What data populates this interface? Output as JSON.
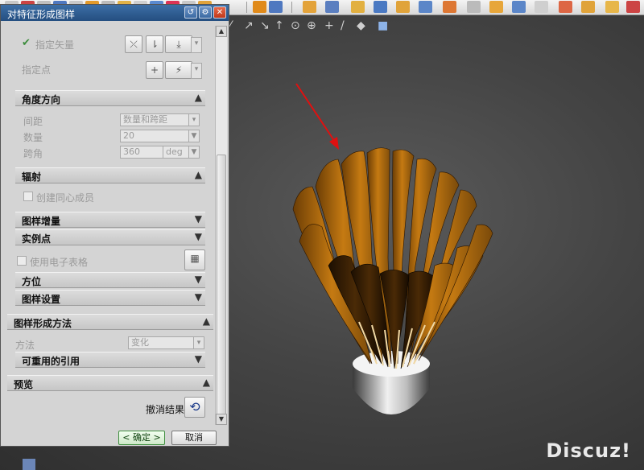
{
  "toolbar": {
    "icons": [
      "feature-icon",
      "cylinder-icon",
      "block-icon",
      "extrude-icon",
      "revolve-icon",
      "boss-icon",
      "pocket-icon",
      "pad-icon",
      "slot-icon",
      "groove-icon",
      "sweep-icon",
      "shell-icon",
      "chamfer-icon",
      "blend-icon",
      "draft-icon",
      "offset-icon",
      "trim-icon",
      "split-icon",
      "sew-icon",
      "pattern-icon",
      "mirror-icon",
      "box-icon",
      "edge-blend-icon"
    ]
  },
  "snapbar": {
    "icons": [
      "line-snap-icon",
      "midpoint-icon",
      "control-point-icon",
      "arc-center-icon",
      "quadrant-icon",
      "intersection-icon",
      "tangent-icon",
      "point-on-curve-icon",
      "face-icon"
    ]
  },
  "dialog": {
    "title": "对特征形成图样",
    "vector_label": "指定矢量",
    "point_label": "指定点",
    "angle_section": "角度方向",
    "spacing_label": "间距",
    "spacing_value": "数量和跨距",
    "count_label": "数量",
    "count_value": "20",
    "span_label": "跨角",
    "span_value": "360",
    "span_unit": "deg",
    "radiate_section": "辐射",
    "concentric_label": "创建同心成员",
    "increment_section": "图样增量",
    "instance_section": "实例点",
    "spreadsheet_label": "使用电子表格",
    "orientation_section": "方位",
    "settings_section": "图样设置",
    "method_section": "图样形成方法",
    "method_label": "方法",
    "method_value": "变化",
    "reuse_section": "可重用的引用",
    "preview_section": "预览",
    "undo_label": "撤消结果",
    "ok_label": "< 确定 >",
    "cancel_label": "取消"
  },
  "watermark": "Discuz!"
}
